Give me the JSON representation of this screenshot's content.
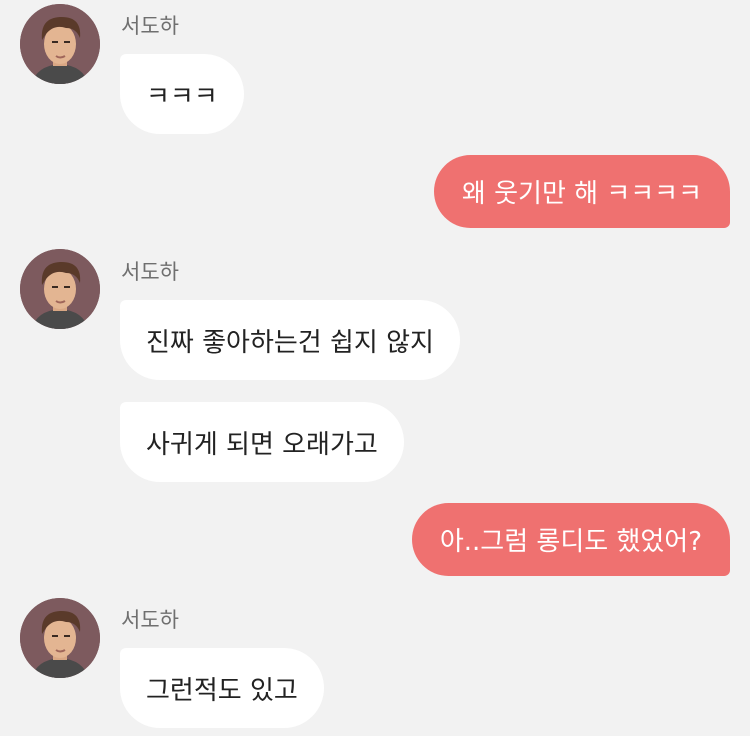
{
  "messages": [
    {
      "side": "in",
      "sender": "서도하",
      "text": "ㅋㅋㅋ"
    },
    {
      "side": "out",
      "text": "왜 웃기만 해 ㅋㅋㅋㅋ"
    },
    {
      "side": "in",
      "sender": "서도하",
      "text": "진짜 좋아하는건 쉽지 않지"
    },
    {
      "side": "in",
      "text": "사귀게 되면 오래가고"
    },
    {
      "side": "out",
      "text": "아..그럼 롱디도 했었어?"
    },
    {
      "side": "in",
      "sender": "서도하",
      "text": "그런적도 있고"
    }
  ],
  "colors": {
    "background": "#f2f2f2",
    "outgoing": "#ef7170",
    "incoming": "#ffffff",
    "avatar": "#7d5a5e"
  },
  "icons": {
    "avatar": "male-portrait-avatar"
  }
}
